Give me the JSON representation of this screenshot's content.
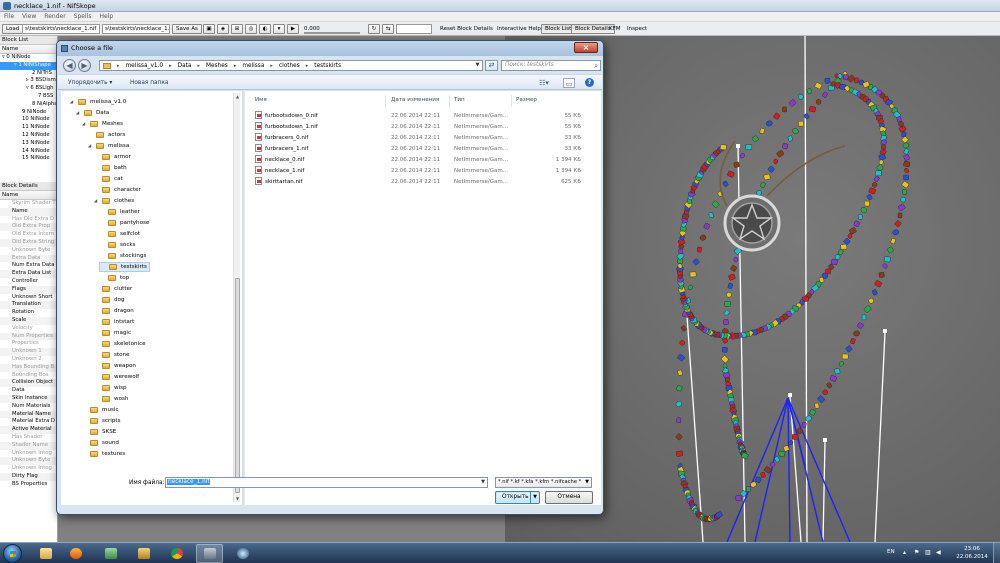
{
  "nifskope": {
    "title": "necklace_1.nif - NifSkope",
    "menu": [
      "File",
      "View",
      "Render",
      "Spells",
      "Help"
    ],
    "toolbar": {
      "load_label": "Load",
      "load_path": "s\\testskirts\\necklace_1.nif",
      "save_path": "s\\testskirts\\necklace_1.nif",
      "save_as_label": "Save As",
      "time_value": "0.000",
      "reset_label": "Reset Block Details",
      "help_label": "Interactive Help",
      "block_list_label": "Block List",
      "block_details_label": "Block Details",
      "kfm_label": "KFM",
      "inspect_label": "Inspect"
    },
    "block_list": {
      "title": "Block List",
      "header": "Name",
      "rows": [
        {
          "text": "▿ 0 NiNode",
          "indent": 2,
          "selected": false
        },
        {
          "text": "▿ 1 NiNiShape",
          "indent": 14,
          "selected": true
        },
        {
          "text": "2 NiTriS",
          "indent": 32,
          "selected": false
        },
        {
          "text": "▹ 3 BSDism",
          "indent": 26,
          "selected": false
        },
        {
          "text": "▿ 6 BSLigh",
          "indent": 26,
          "selected": false
        },
        {
          "text": "7 BSS",
          "indent": 38,
          "selected": false
        },
        {
          "text": "8 NiAlphaPr",
          "indent": 32,
          "selected": false
        },
        {
          "text": "9 NiNode",
          "indent": 22,
          "selected": false
        },
        {
          "text": "10 NiNode",
          "indent": 22,
          "selected": false
        },
        {
          "text": "11 NiNode",
          "indent": 22,
          "selected": false
        },
        {
          "text": "12 NiNode",
          "indent": 22,
          "selected": false
        },
        {
          "text": "13 NiNode",
          "indent": 22,
          "selected": false
        },
        {
          "text": "14 NiNode",
          "indent": 22,
          "selected": false
        },
        {
          "text": "15 NiNode",
          "indent": 22,
          "selected": false
        }
      ]
    },
    "block_details": {
      "title": "Block Details",
      "header": "Name",
      "rows": [
        {
          "text": "Skyrim Shader T",
          "dim": true
        },
        {
          "text": "Name",
          "dim": false
        },
        {
          "text": "Has Old Extra D",
          "dim": true
        },
        {
          "text": "Old Extra Prop",
          "dim": true
        },
        {
          "text": "Old Extra Intern",
          "dim": true
        },
        {
          "text": "Old Extra String",
          "dim": true
        },
        {
          "text": "Unknown Byte",
          "dim": true
        },
        {
          "text": "Extra Data",
          "dim": true
        },
        {
          "text": "Num Extra Data",
          "dim": false
        },
        {
          "text": "Extra Data List",
          "dim": false
        },
        {
          "text": "Controller",
          "dim": false
        },
        {
          "text": "Flags",
          "dim": false
        },
        {
          "text": "Unknown Short",
          "dim": false
        },
        {
          "text": "Translation",
          "dim": false
        },
        {
          "text": "Rotation",
          "dim": false
        },
        {
          "text": "Scale",
          "dim": false
        },
        {
          "text": "Velocity",
          "dim": true
        },
        {
          "text": "Num Properties",
          "dim": true
        },
        {
          "text": "Properties",
          "dim": true
        },
        {
          "text": "Unknown 1",
          "dim": true
        },
        {
          "text": "Unknown 2",
          "dim": true
        },
        {
          "text": "Has Bounding B",
          "dim": true
        },
        {
          "text": "Bounding Box",
          "dim": true
        },
        {
          "text": "Collision Object",
          "dim": false
        },
        {
          "text": "Data",
          "dim": false
        },
        {
          "text": "Skin Instance",
          "dim": false
        },
        {
          "text": "Num Materials",
          "dim": false
        },
        {
          "text": "Material Name",
          "dim": false
        },
        {
          "text": "Material Extra D",
          "dim": false
        },
        {
          "text": "Active Material",
          "dim": false
        },
        {
          "text": "Has Shader",
          "dim": true
        },
        {
          "text": "Shader Name",
          "dim": true
        },
        {
          "text": "Unknown Integ",
          "dim": true
        },
        {
          "text": "Unknown Byte",
          "dim": true
        },
        {
          "text": "Unknown Integ",
          "dim": true
        },
        {
          "text": "Dirty Flag",
          "dim": false
        },
        {
          "text": "BS Properties",
          "dim": false
        }
      ]
    }
  },
  "dialog": {
    "title": "Choose a file",
    "address": [
      "melissa_v1.0",
      "Data",
      "Meshes",
      "melissa",
      "clothes",
      "testskirts"
    ],
    "search_placeholder": "Поиск: testskirts",
    "organize_label": "Упорядочить ▾",
    "new_folder_label": "Новая папка",
    "tree": [
      {
        "label": "melissa_v1.0",
        "level": 0,
        "selected": false
      },
      {
        "label": "Data",
        "level": 1,
        "selected": false
      },
      {
        "label": "Meshes",
        "level": 2,
        "selected": false
      },
      {
        "label": "actors",
        "level": 3,
        "selected": false
      },
      {
        "label": "melissa",
        "level": 3,
        "selected": false
      },
      {
        "label": "armor",
        "level": 4,
        "selected": false
      },
      {
        "label": "bath",
        "level": 4,
        "selected": false
      },
      {
        "label": "cat",
        "level": 4,
        "selected": false
      },
      {
        "label": "character",
        "level": 4,
        "selected": false
      },
      {
        "label": "clothes",
        "level": 4,
        "selected": false
      },
      {
        "label": "leather",
        "level": 5,
        "selected": false
      },
      {
        "label": "pantyhose",
        "level": 5,
        "selected": false
      },
      {
        "label": "selfclot",
        "level": 5,
        "selected": false
      },
      {
        "label": "socks",
        "level": 5,
        "selected": false
      },
      {
        "label": "stockings",
        "level": 5,
        "selected": false
      },
      {
        "label": "testskirts",
        "level": 5,
        "selected": true
      },
      {
        "label": "top",
        "level": 5,
        "selected": false
      },
      {
        "label": "clutter",
        "level": 4,
        "selected": false
      },
      {
        "label": "dog",
        "level": 4,
        "selected": false
      },
      {
        "label": "dragon",
        "level": 4,
        "selected": false
      },
      {
        "label": "intstart",
        "level": 4,
        "selected": false
      },
      {
        "label": "magic",
        "level": 4,
        "selected": false
      },
      {
        "label": "skeletonice",
        "level": 4,
        "selected": false
      },
      {
        "label": "stone",
        "level": 4,
        "selected": false
      },
      {
        "label": "weapon",
        "level": 4,
        "selected": false
      },
      {
        "label": "werewolf",
        "level": 4,
        "selected": false
      },
      {
        "label": "wisp",
        "level": 4,
        "selected": false
      },
      {
        "label": "wosh",
        "level": 4,
        "selected": false
      },
      {
        "label": "music",
        "level": 2,
        "selected": false
      },
      {
        "label": "scripts",
        "level": 2,
        "selected": false
      },
      {
        "label": "SKSE",
        "level": 2,
        "selected": false
      },
      {
        "label": "sound",
        "level": 2,
        "selected": false
      },
      {
        "label": "textures",
        "level": 2,
        "selected": false
      }
    ],
    "columns": {
      "name": "Имя",
      "date": "Дата изменения",
      "type": "Тип",
      "size": "Размер"
    },
    "files": [
      {
        "name": "furbootsdown_0.nif",
        "date": "22.06.2014 22:11",
        "type": "NetImmerse/Gam...",
        "size": "55 КБ"
      },
      {
        "name": "furbootsdown_1.nif",
        "date": "22.06.2014 22:11",
        "type": "NetImmerse/Gam...",
        "size": "55 КБ"
      },
      {
        "name": "furbracers_0.nif",
        "date": "22.06.2014 22:11",
        "type": "NetImmerse/Gam...",
        "size": "33 КБ"
      },
      {
        "name": "furbracers_1.nif",
        "date": "22.06.2014 22:11",
        "type": "NetImmerse/Gam...",
        "size": "33 КБ"
      },
      {
        "name": "necklace_0.nif",
        "date": "22.06.2014 22:11",
        "type": "NetImmerse/Gam...",
        "size": "1 394 КБ"
      },
      {
        "name": "necklace_1.nif",
        "date": "22.06.2014 22:11",
        "type": "NetImmerse/Gam...",
        "size": "1 394 КБ"
      },
      {
        "name": "skirttartan.nif",
        "date": "22.06.2014 22:11",
        "type": "NetImmerse/Gam...",
        "size": "625 КБ"
      }
    ],
    "filename_label": "Имя файла:",
    "filename_value": "necklace_1.nif",
    "filter_value": "*.nif *.kf *.kfa *.kfm *.nifcache *",
    "open_label": "Открыть",
    "cancel_label": "Отмена"
  },
  "taskbar": {
    "lang": "EN",
    "time": "23:06",
    "date": "22.06.2014"
  },
  "colors": {
    "selection": "#3399ff",
    "viewport_bg": "#6a6a6a",
    "taskbar": "#1e3350"
  }
}
